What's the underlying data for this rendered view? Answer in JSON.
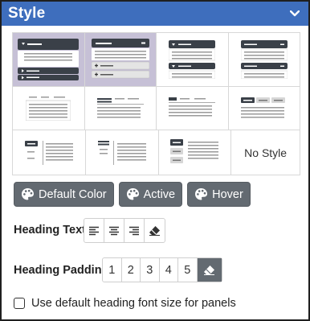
{
  "header": {
    "title": "Style",
    "collapse_icon": "chevron-down-icon"
  },
  "style_grid": {
    "selected_index": 0,
    "no_style_label": "No Style"
  },
  "color_buttons": [
    {
      "label": "Default Color",
      "icon": "palette-icon"
    },
    {
      "label": "Active",
      "icon": "palette-icon"
    },
    {
      "label": "Hover",
      "icon": "palette-icon"
    }
  ],
  "heading_text": {
    "label": "Heading Text",
    "options": [
      "align-left-icon",
      "align-center-icon",
      "align-right-icon",
      "eraser-icon"
    ]
  },
  "heading_padding": {
    "label": "Heading Padding",
    "options": [
      "1",
      "2",
      "3",
      "4",
      "5"
    ],
    "clear_icon": "eraser-icon",
    "clear_active": true
  },
  "checkbox": {
    "label": "Use default heading font size for panels",
    "checked": false
  },
  "colors": {
    "header_bg": "#3e6ebd",
    "button_bg": "#636a71",
    "selected_bg": "#c6c0d6"
  }
}
